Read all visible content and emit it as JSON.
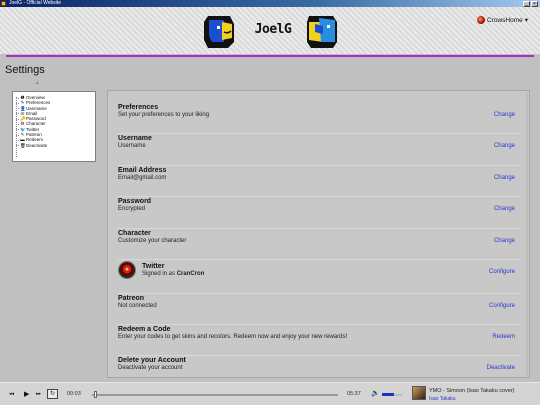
{
  "window": {
    "title": "JoelG - Official Website"
  },
  "header": {
    "brand": "JoelG",
    "user_name": "CrowsHome",
    "user_caret": "▾",
    "accent_color": "#a030c8"
  },
  "page": {
    "title": "Settings",
    "pin_glyph": "⊥"
  },
  "sidebar": {
    "items": [
      {
        "icon": "info-icon",
        "glyph": "❶",
        "label": "Overview"
      },
      {
        "icon": "pencil-icon",
        "glyph": "✎",
        "label": "Preferences"
      },
      {
        "icon": "user-icon",
        "glyph": "👤",
        "label": "Username"
      },
      {
        "icon": "mail-icon",
        "glyph": "✉",
        "label": "Email"
      },
      {
        "icon": "key-icon",
        "glyph": "🔑",
        "label": "Password"
      },
      {
        "icon": "character-icon",
        "glyph": "⚙",
        "label": "Character"
      },
      {
        "icon": "twitter-icon",
        "glyph": "🐦",
        "label": "Twitter"
      },
      {
        "icon": "patreon-icon",
        "glyph": "✎",
        "label": "Patreon"
      },
      {
        "icon": "ticket-icon",
        "glyph": "▬",
        "label": "Redeem"
      },
      {
        "icon": "trash-icon",
        "glyph": "🗑",
        "label": "Deactivate"
      }
    ]
  },
  "settings": {
    "preferences": {
      "title": "Preferences",
      "subtitle": "Set your preferences to your liking",
      "action": "Change"
    },
    "username": {
      "title": "Username",
      "subtitle": "Username",
      "action": "Change"
    },
    "email": {
      "title": "Email Address",
      "subtitle": "Email@gmail.com",
      "action": "Change"
    },
    "password": {
      "title": "Password",
      "subtitle": "Encrypted",
      "action": "Change"
    },
    "character": {
      "title": "Character",
      "subtitle": "Customize your character",
      "action": "Change"
    },
    "twitter": {
      "title": "Twitter",
      "subtitle_prefix": "Signed in as ",
      "handle": "CranCron",
      "action": "Configure"
    },
    "patreon": {
      "title": "Patreon",
      "subtitle": "Not connected",
      "action": "Configure"
    },
    "redeem": {
      "title": "Redeem a Code",
      "subtitle": "Enter your codes to get skins and recolors. Redeem now and enjoy your new rewards!",
      "action": "Redeem"
    },
    "delete": {
      "title": "Delete your Account",
      "subtitle": "Deactivate your account",
      "action": "Deactivate"
    }
  },
  "player": {
    "prev_glyph": "◂◂",
    "play_glyph": "▶",
    "next_glyph": "▸▸",
    "loop_glyph": "↻",
    "elapsed": "00:03",
    "duration": "05:37",
    "progress": 0.01,
    "volume": 0.6,
    "volume_glyph": "🔈",
    "track": "YMO - Simoon (Isao Takaku cover)",
    "artist": "Isao Takaku",
    "link_color": "#2a36d0"
  }
}
